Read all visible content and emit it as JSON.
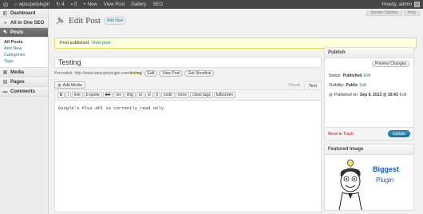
{
  "adminbar": {
    "site_name": "wpsuperplugin",
    "updates_count": "4",
    "comments_count": "0",
    "new_label": "New",
    "view_post": "View Post",
    "gallery": "Gallery",
    "seo": "SEO",
    "howdy": "Howdy, admin"
  },
  "sidebar": {
    "dashboard": "Dashboard",
    "all_in_one_seo": "All in One SEO",
    "posts": "Posts",
    "sub": [
      "All Posts",
      "Add New",
      "Categories",
      "Tags"
    ],
    "media": "Media",
    "pages": "Pages",
    "comments": "Comments"
  },
  "header": {
    "screen_options": "Screen Options",
    "help": "Help",
    "title": "Edit Post",
    "add_new": "Add New"
  },
  "notice": {
    "text": "Post published.",
    "link": "View post"
  },
  "post": {
    "title": "Testing",
    "permalink_label": "Permalink:",
    "permalink_base": "http://www.wpsuperplugin.com/",
    "permalink_slug": "testing",
    "permalink_end": "/",
    "edit_btn": "Edit",
    "view_post_btn": "View Post",
    "shortlink_btn": "Get Shortlink",
    "add_media": "Add Media",
    "tab_visual": "Visual",
    "tab_text": "Text",
    "toolbar": [
      "b",
      "i",
      "link",
      "b-quote",
      "del",
      "ins",
      "img",
      "ul",
      "ol",
      "li",
      "code",
      "more",
      "close tags",
      "fullscreen"
    ],
    "content": "Google's Plus API is currently read only"
  },
  "publish": {
    "heading": "Publish",
    "preview": "Preview Changes",
    "status_label": "Status:",
    "status_value": "Published",
    "visibility_label": "Visibility:",
    "visibility_value": "Public",
    "published_label": "Published on:",
    "published_value": "Sep 6, 2013 @ 20:43",
    "edit": "Edit",
    "trash": "Move to Trash",
    "update": "Update"
  },
  "featured": {
    "heading": "Featured Image",
    "logo_line1": "Biggest",
    "logo_line2": "Plugin"
  },
  "colors": {
    "admin_bar": "#464646",
    "link": "#21759b",
    "update_button": "#21759b",
    "notice_bg": "#ffffe0",
    "trash": "#bc0b0b"
  }
}
